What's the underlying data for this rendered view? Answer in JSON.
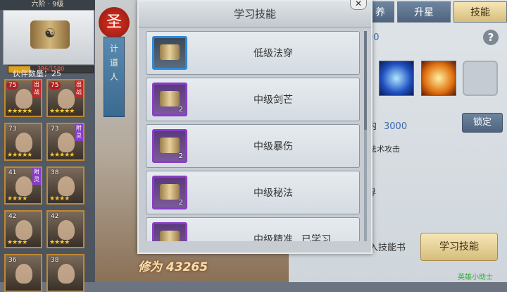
{
  "left_panel": {
    "rank": "六阶 · 9级",
    "exp": {
      "current": 386,
      "max": 1500,
      "text": "386/1500"
    },
    "partner_count": "伙伴数量：25",
    "cards": [
      {
        "level": "75",
        "tag": "出战",
        "tag_color": "red",
        "stars": "★★★★★",
        "border": "gold"
      },
      {
        "level": "75",
        "tag": "出战",
        "tag_color": "red",
        "stars": "★★★★★",
        "border": "gold"
      },
      {
        "level": "73",
        "tag": "",
        "tag_color": "",
        "stars": "★★★★★",
        "border": "gold"
      },
      {
        "level": "73",
        "tag": "附灵",
        "tag_color": "purple",
        "stars": "★★★★★",
        "border": "gold"
      },
      {
        "level": "41",
        "tag": "附灵",
        "tag_color": "purple",
        "stars": "★★★★",
        "border": "gold"
      },
      {
        "level": "38",
        "tag": "",
        "tag_color": "",
        "stars": "★★★★",
        "border": "gold"
      },
      {
        "level": "42",
        "tag": "",
        "tag_color": "",
        "stars": "★★★★",
        "border": "gold"
      },
      {
        "level": "42",
        "tag": "",
        "tag_color": "",
        "stars": "★★★★",
        "border": "gold"
      },
      {
        "level": "36",
        "tag": "",
        "tag_color": "",
        "stars": "",
        "border": "gold"
      },
      {
        "level": "38",
        "tag": "",
        "tag_color": "",
        "stars": "",
        "border": "gold"
      }
    ]
  },
  "middle": {
    "badge": "圣",
    "banner_text": "计\n道\n人",
    "cultivation": "修为 43265"
  },
  "right_panel": {
    "tabs": [
      {
        "label": "养",
        "active": false
      },
      {
        "label": "升星",
        "active": false
      },
      {
        "label": "技能",
        "active": true
      }
    ],
    "partial_number": "00",
    "help": "?",
    "power_label": "内",
    "power_value": "3000",
    "lock_label": "锁定",
    "attack_type": "法术攻击",
    "partial_text": "界",
    "skillbook_label": "入技能书",
    "learn_button": "学习技能",
    "watermark": "英雄小助士",
    "colors": {
      "accent_blue": "#3a6ab0",
      "gold_button": "#d6bd7c"
    }
  },
  "modal": {
    "title": "学习技能",
    "close": "✕",
    "items": [
      {
        "name": "低级法穿",
        "count": "",
        "rarity": "blue",
        "status": ""
      },
      {
        "name": "中级剑芒",
        "count": "2",
        "rarity": "purple",
        "status": ""
      },
      {
        "name": "中级暴伤",
        "count": "2",
        "rarity": "purple",
        "status": ""
      },
      {
        "name": "中级秘法",
        "count": "2",
        "rarity": "purple",
        "status": ""
      },
      {
        "name": "中级精准",
        "count": "",
        "rarity": "purple",
        "status": "已学习"
      }
    ]
  }
}
